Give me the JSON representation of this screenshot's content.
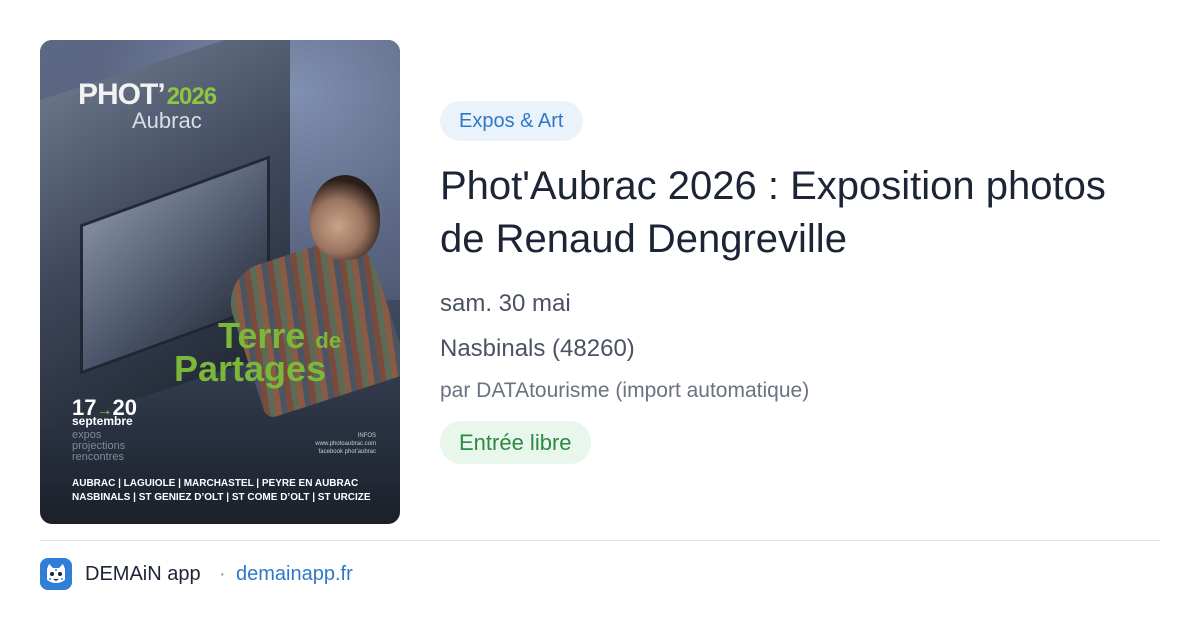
{
  "poster": {
    "logo_main": "PHOT’",
    "logo_year": "2026",
    "logo_sub": "Aubrac",
    "theme_line1": "Terre",
    "theme_de": "de",
    "theme_line2": "Partages",
    "date_start": "17",
    "date_arrow": "→",
    "date_end": "20",
    "date_month": "septembre",
    "kinds": [
      "expos",
      "projections",
      "rencontres"
    ],
    "infos": [
      "INFOS",
      "www.photoaubrac.com",
      "facebook phot’aubrac"
    ],
    "towns_line1": "AUBRAC | LAGUIOLE | MARCHASTEL | PEYRE EN AUBRAC",
    "towns_line2": "NASBINALS | ST GENIEZ D’OLT | ST COME D’OLT | ST URCIZE"
  },
  "event": {
    "category": "Expos & Art",
    "title": "Phot'Aubrac 2026 : Exposition photos de Renaud Dengreville",
    "date": "sam. 30 mai",
    "location": "Nasbinals (48260)",
    "source": "par DATAtourisme (import automatique)",
    "price": "Entrée libre"
  },
  "footer": {
    "app_name": "DEMAiN app",
    "separator": "·",
    "site": "demainapp.fr",
    "app_icon": "leopard-mascot-icon"
  },
  "colors": {
    "category_bg": "#eaf2fc",
    "category_text": "#2f78c8",
    "price_bg": "#e9f6ec",
    "price_text": "#2c8a44",
    "link": "#2f78c8",
    "poster_green": "#7bb83a"
  }
}
